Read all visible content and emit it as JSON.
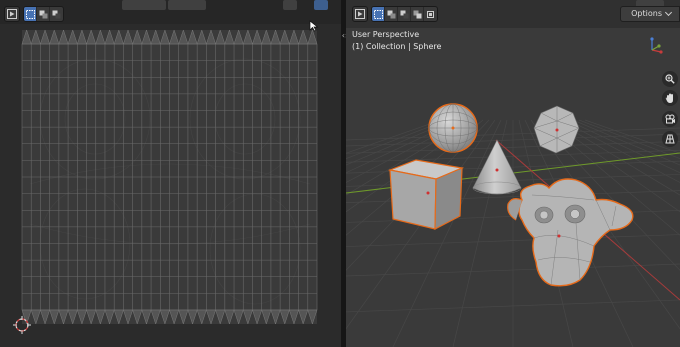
{
  "uv_editor": {
    "header_icons": [
      "editor-type-icon",
      "select-mode-icon",
      "select-extend-icon",
      "select-subtract-icon"
    ]
  },
  "viewport": {
    "view_name": "User Perspective",
    "collection_label": "(1) Collection | Sphere",
    "options_label": "Options",
    "side_tools": [
      "zoom-icon",
      "pan-hand-icon",
      "camera-icon",
      "grid-view-icon"
    ],
    "objects": [
      "Sphere",
      "Icosphere",
      "Cone",
      "Cube",
      "Suzanne"
    ],
    "selected_outline_color": "#e66a1a",
    "axis_x_color": "#b33b3b",
    "axis_y_color": "#6f9a2a"
  }
}
